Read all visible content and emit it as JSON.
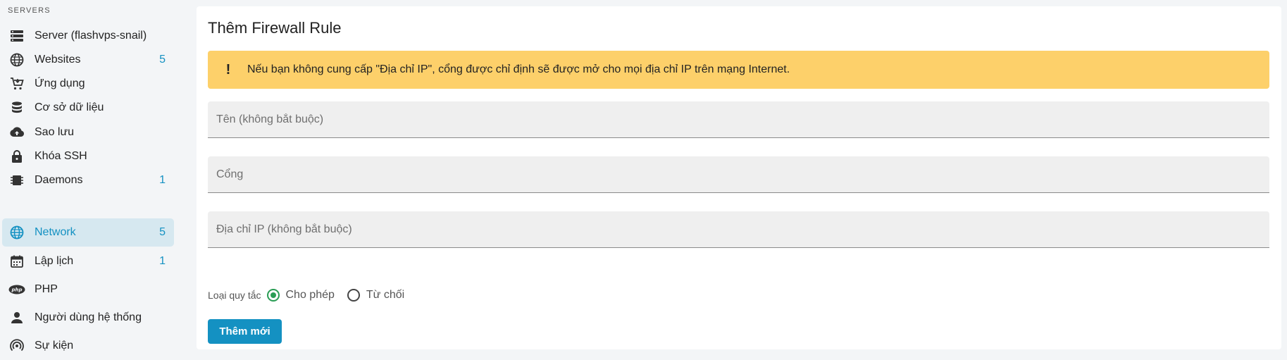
{
  "sidebar": {
    "heading": "SERVERS",
    "items": [
      {
        "label": "Server (flashvps-snail)",
        "count": ""
      },
      {
        "label": "Websites",
        "count": "5"
      },
      {
        "label": "Ứng dụng",
        "count": ""
      },
      {
        "label": "Cơ sở dữ liệu",
        "count": ""
      },
      {
        "label": "Sao lưu",
        "count": ""
      },
      {
        "label": "Khóa SSH",
        "count": ""
      },
      {
        "label": "Daemons",
        "count": "1"
      },
      {
        "label": "Network",
        "count": "5"
      },
      {
        "label": "Lập lịch",
        "count": "1"
      },
      {
        "label": "PHP",
        "count": ""
      },
      {
        "label": "Người dùng hệ thống",
        "count": ""
      },
      {
        "label": "Sự kiện",
        "count": ""
      }
    ],
    "icons": [
      "server-icon",
      "globe-icon",
      "cart-icon",
      "database-icon",
      "cloud-upload-icon",
      "lock-icon",
      "chip-icon",
      "globe-icon",
      "calendar-icon",
      "php-icon",
      "user-icon",
      "broadcast-icon"
    ],
    "active": "Network"
  },
  "main": {
    "title": "Thêm Firewall Rule",
    "alert": {
      "icon": "!",
      "text": "Nếu bạn không cung cấp \"Địa chỉ IP\", cổng được chỉ định sẽ được mở cho mọi địa chỉ IP trên mạng Internet."
    },
    "fields": {
      "name_placeholder": "Tên (không bắt buộc)",
      "name_value": "",
      "port_placeholder": "Cổng",
      "port_value": "",
      "ip_placeholder": "Địa chỉ IP (không bắt buộc)",
      "ip_value": ""
    },
    "rule_type": {
      "label": "Loại quy tắc",
      "options": [
        "Cho phép",
        "Từ chối"
      ],
      "selected": "Cho phép"
    },
    "submit_label": "Thêm mới"
  },
  "colors": {
    "accent": "#1491c2",
    "alert_bg": "#fdd06a",
    "radio_checked": "#2a9d55",
    "active_item_bg": "#d6e8f0"
  }
}
